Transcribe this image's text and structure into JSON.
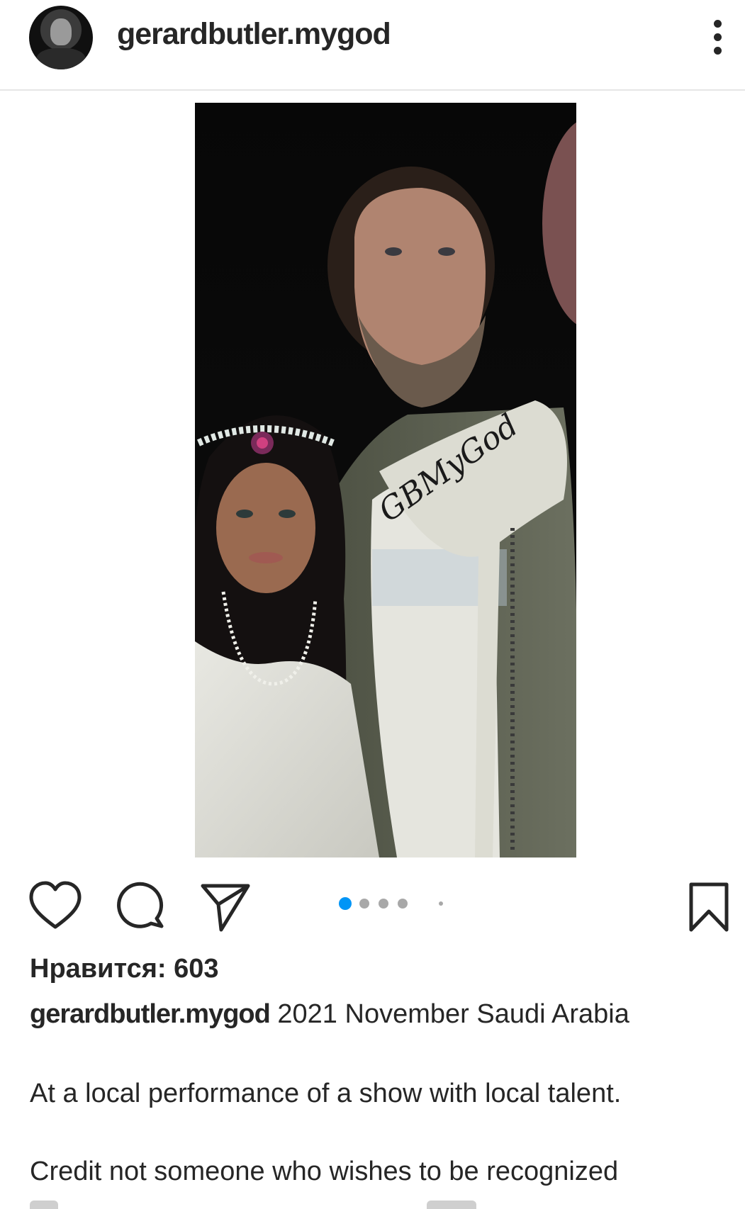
{
  "post": {
    "username": "gerardbutler.mygod",
    "photo_watermark": "GBMyGod",
    "carousel": {
      "total_dots": 5,
      "active_index": 0
    },
    "likes_text": "Нравится: 603",
    "caption": {
      "username": "gerardbutler.mygod",
      "text": "2021 November Saudi Arabia"
    },
    "paragraphs": [
      "At a local performance of a show with local talent.",
      "Credit not someone who wishes to be recognized"
    ]
  },
  "icons": {
    "more": "more-vertical-icon",
    "like": "heart-icon",
    "comment": "comment-icon",
    "share": "share-icon",
    "save": "bookmark-icon"
  },
  "colors": {
    "text": "#262626",
    "active_dot": "#0095f6",
    "inactive_dot": "#a8a8a8",
    "divider": "#e6e6e6"
  }
}
